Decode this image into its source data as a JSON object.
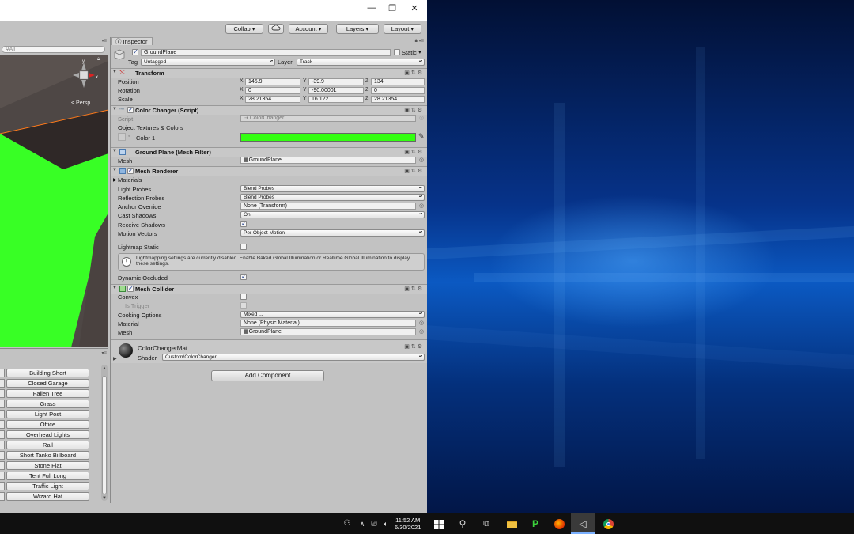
{
  "toolbar": {
    "collab": "Collab ▾",
    "cloud_icon": "cloud-icon",
    "account": "Account",
    "layers": "Layers",
    "layout": "Layout"
  },
  "scene": {
    "search_placeholder": "All",
    "persp_label": "< Persp"
  },
  "project": {
    "assets": [
      "Building Short",
      "Closed Garage",
      "Fallen Tree",
      "Grass",
      "Light Post",
      "Office",
      "Overhead Lights",
      "Rail",
      "Short Tanko Billboard",
      "Stone Flat",
      "Tent Full Long",
      "Traffic Light",
      "Wizard Hat"
    ]
  },
  "inspector": {
    "tab": "Inspector",
    "object_name": "GroundPlane",
    "static_label": "Static",
    "tag_label": "Tag",
    "tag_value": "Untagged",
    "layer_label": "Layer",
    "layer_value": "Track",
    "transform": {
      "title": "Transform",
      "position_label": "Position",
      "rotation_label": "Rotation",
      "scale_label": "Scale",
      "position": {
        "x": "145.9",
        "y": "-39.9",
        "z": "134"
      },
      "rotation": {
        "x": "0",
        "y": "-90.00001",
        "z": "0"
      },
      "scale": {
        "x": "28.21354",
        "y": "16.122",
        "z": "28.21354"
      }
    },
    "color_changer": {
      "title": "Color Changer (Script)",
      "script_label": "Script",
      "script_value": "ColorChanger",
      "section_label": "Object Textures & Colors",
      "color1_label": "Color 1",
      "color1": "#33ff11"
    },
    "mesh_filter": {
      "title": "Ground Plane (Mesh Filter)",
      "mesh_label": "Mesh",
      "mesh_value": "GroundPlane"
    },
    "mesh_renderer": {
      "title": "Mesh Renderer",
      "materials_label": "Materials",
      "light_probes_label": "Light Probes",
      "light_probes_value": "Blend Probes",
      "reflection_probes_label": "Reflection Probes",
      "reflection_probes_value": "Blend Probes",
      "anchor_override_label": "Anchor Override",
      "anchor_override_value": "None (Transform)",
      "cast_shadows_label": "Cast Shadows",
      "cast_shadows_value": "On",
      "receive_shadows_label": "Receive Shadows",
      "motion_vectors_label": "Motion Vectors",
      "motion_vectors_value": "Per Object Motion",
      "lightmap_static_label": "Lightmap Static",
      "info_text": "Lightmapping settings are currently disabled. Enable Baked Global Illumination or Realtime Global Illumination to display these settings.",
      "dynamic_occluded_label": "Dynamic Occluded"
    },
    "mesh_collider": {
      "title": "Mesh Collider",
      "convex_label": "Convex",
      "is_trigger_label": "Is Trigger",
      "cooking_options_label": "Cooking Options",
      "cooking_options_value": "Mixed ...",
      "material_label": "Material",
      "material_value": "None (Physic Material)",
      "mesh_label": "Mesh",
      "mesh_value": "GroundPlane"
    },
    "material": {
      "name": "ColorChangerMat",
      "shader_label": "Shader",
      "shader_value": "Custom/ColorChanger"
    },
    "add_component": "Add Component"
  },
  "taskbar": {
    "time": "11:52 AM",
    "date": "6/30/2021"
  }
}
